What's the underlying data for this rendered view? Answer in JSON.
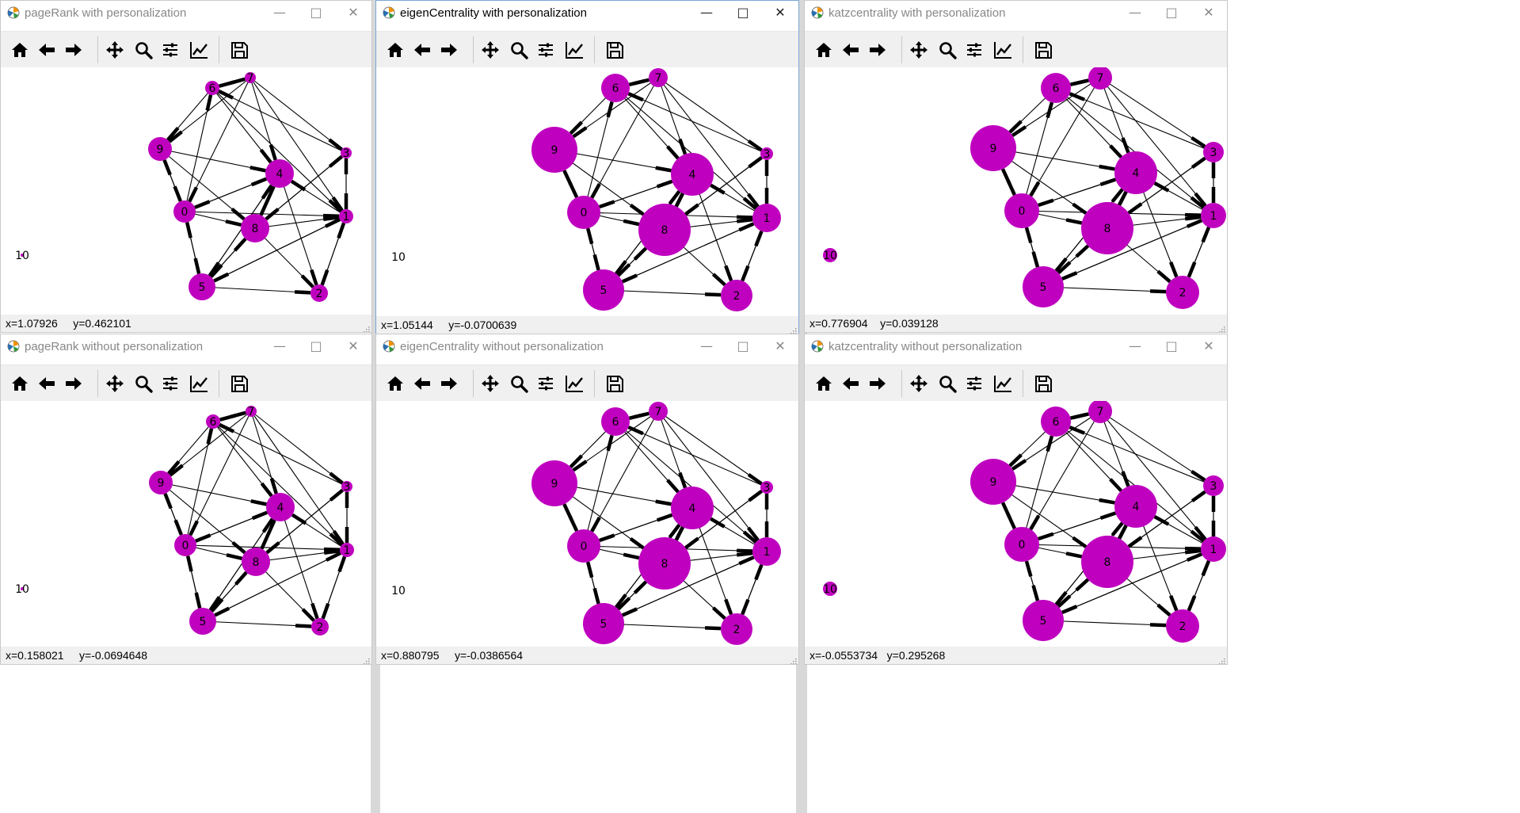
{
  "colors": {
    "node": "#bf00bf",
    "edge": "#000000"
  },
  "toolbar_icons": [
    "home-icon",
    "back-arrow-icon",
    "forward-arrow-icon",
    "pan-icon",
    "zoom-icon",
    "configure-subplots-icon",
    "edit-axis-icon",
    "save-icon"
  ],
  "windows": [
    {
      "title": "pageRank with personalization",
      "status": "x=1.07926     y=0.462101"
    },
    {
      "title": "eigenCentrality with personalization",
      "status": "x=1.05144     y=-0.0700639"
    },
    {
      "title": "katzcentrality with personalization",
      "status": "x=0.776904    y=0.039128"
    },
    {
      "title": "pageRank without personalization",
      "status": "x=0.158021     y=-0.0694648"
    },
    {
      "title": "eigenCentrality without personalization",
      "status": "x=0.880795     y=-0.0386564"
    },
    {
      "title": "katzcentrality without personalization",
      "status": "x=-0.0553734   y=0.295268"
    }
  ],
  "graph": {
    "nodes": [
      "0",
      "1",
      "2",
      "3",
      "4",
      "5",
      "6",
      "7",
      "8",
      "9",
      "10"
    ],
    "edges": [
      [
        6,
        7
      ],
      [
        7,
        6
      ],
      [
        6,
        4
      ],
      [
        6,
        1
      ],
      [
        6,
        9
      ],
      [
        7,
        9
      ],
      [
        7,
        0
      ],
      [
        7,
        4
      ],
      [
        7,
        3
      ],
      [
        7,
        1
      ],
      [
        9,
        0
      ],
      [
        9,
        4
      ],
      [
        9,
        8
      ],
      [
        0,
        9
      ],
      [
        0,
        8
      ],
      [
        0,
        5
      ],
      [
        0,
        4
      ],
      [
        0,
        6
      ],
      [
        0,
        1
      ],
      [
        4,
        0
      ],
      [
        4,
        8
      ],
      [
        4,
        2
      ],
      [
        4,
        5
      ],
      [
        8,
        4
      ],
      [
        8,
        1
      ],
      [
        8,
        5
      ],
      [
        8,
        2
      ],
      [
        8,
        3
      ],
      [
        5,
        0
      ],
      [
        5,
        8
      ],
      [
        5,
        2
      ],
      [
        5,
        4
      ],
      [
        5,
        1
      ],
      [
        1,
        3
      ],
      [
        1,
        2
      ],
      [
        1,
        4
      ],
      [
        1,
        5
      ],
      [
        2,
        1
      ],
      [
        3,
        1
      ],
      [
        3,
        8
      ],
      [
        3,
        6
      ]
    ]
  },
  "chart_sizes": [
    [
      14,
      9,
      11,
      7,
      18,
      17,
      9,
      7,
      18,
      15,
      2
    ],
    [
      21,
      18,
      20,
      8,
      27,
      26,
      18,
      12,
      33,
      29,
      0
    ],
    [
      22,
      16,
      21,
      13,
      27,
      26,
      19,
      15,
      33,
      29,
      9
    ],
    [
      14,
      9,
      11,
      7,
      18,
      17,
      9,
      7,
      18,
      15,
      2
    ],
    [
      21,
      18,
      20,
      8,
      27,
      26,
      18,
      12,
      33,
      29,
      0
    ],
    [
      22,
      16,
      21,
      13,
      27,
      26,
      19,
      15,
      33,
      29,
      9
    ]
  ]
}
